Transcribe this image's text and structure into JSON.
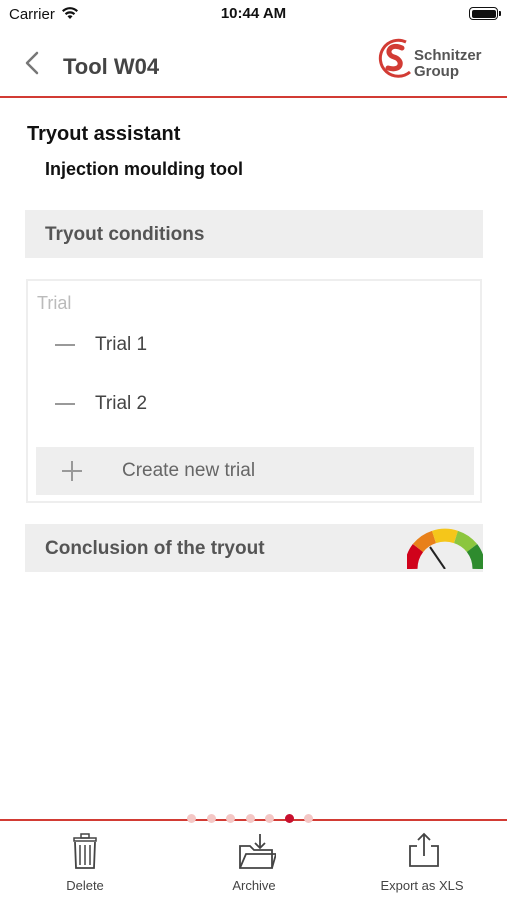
{
  "status_bar": {
    "carrier": "Carrier",
    "time": "10:44 AM"
  },
  "nav": {
    "title": "Tool W04",
    "logo_line1": "Schnitzer",
    "logo_line2": "Group"
  },
  "content": {
    "title": "Tryout assistant",
    "subtitle": "Injection moulding tool",
    "conditions_label": "Tryout conditions",
    "trial_header": "Trial",
    "trials": [
      {
        "label": "Trial 1"
      },
      {
        "label": "Trial 2"
      }
    ],
    "create_trial_label": "Create new trial",
    "conclusion_label": "Conclusion of the tryout"
  },
  "pager": {
    "count": 7,
    "active_index": 5
  },
  "toolbar": {
    "delete_label": "Delete",
    "archive_label": "Archive",
    "export_label": "Export as XLS"
  },
  "icons": {
    "back": "chevron-left-icon",
    "logo": "schnitzer-logo",
    "gauge": "gauge-icon",
    "delete": "trash-icon",
    "archive": "folder-download-icon",
    "export": "share-upload-icon"
  },
  "colors": {
    "accent": "#d23b34",
    "panel": "#eeeeee",
    "dot_active": "#c8102e",
    "dot_inactive": "#f4c7c5"
  }
}
